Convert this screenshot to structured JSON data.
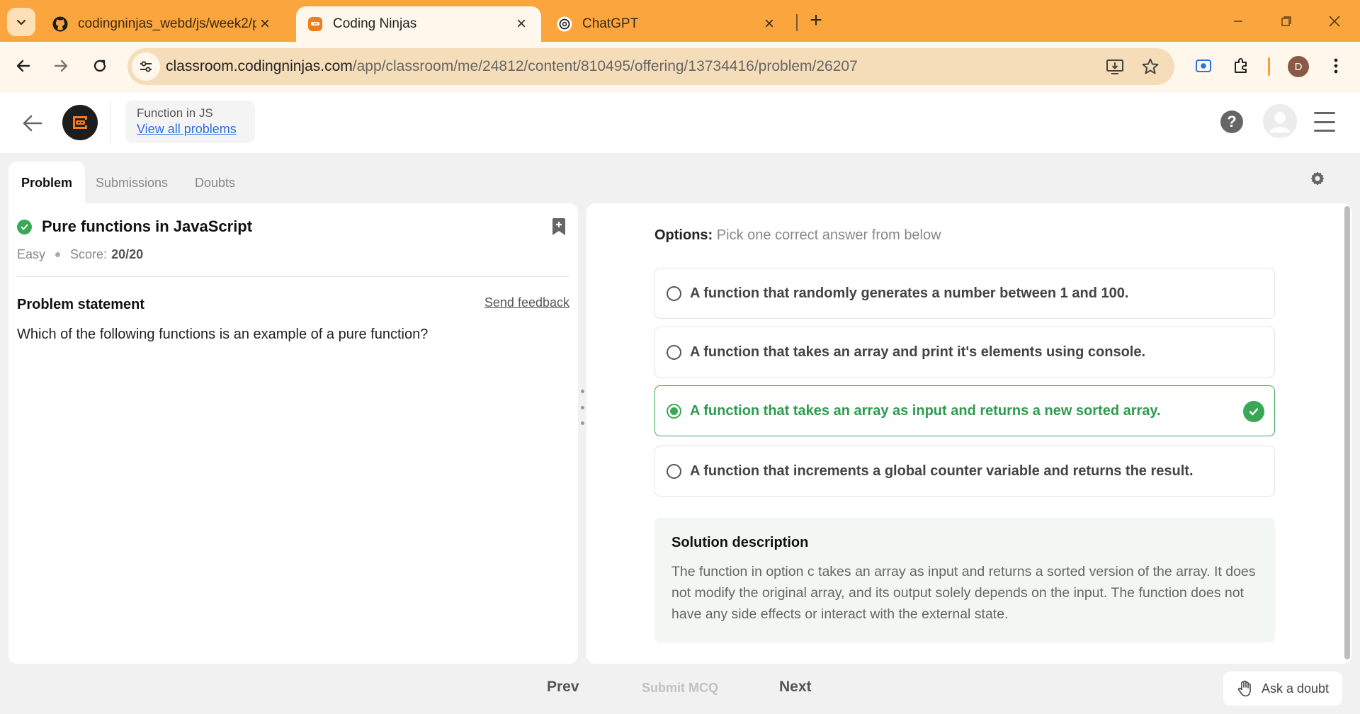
{
  "browser": {
    "tabs": [
      {
        "title": "codingninjas_webd/js/week2/p",
        "active": false
      },
      {
        "title": "Coding Ninjas",
        "active": true
      },
      {
        "title": "ChatGPT",
        "active": false
      }
    ],
    "url_host": "classroom.codingninjas.com",
    "url_path": "/app/classroom/me/24812/content/810495/offering/13734416/problem/26207",
    "profile_initial": "D",
    "accent_color": "#fba53f"
  },
  "header": {
    "breadcrumb_title": "Function in JS",
    "breadcrumb_link": "View all problems",
    "help_label": "?"
  },
  "tabs": {
    "problem": "Problem",
    "submissions": "Submissions",
    "doubts": "Doubts"
  },
  "problem": {
    "title": "Pure functions in JavaScript",
    "difficulty": "Easy",
    "score_label": "Score:",
    "score_value": "20/20",
    "statement_heading": "Problem statement",
    "feedback_link": "Send feedback",
    "statement": "Which of the following functions is an example of a pure function?"
  },
  "options": {
    "heading": "Options:",
    "hint": "Pick one correct answer from below",
    "items": [
      {
        "text": "A function that randomly generates a number between 1 and 100.",
        "selected": false
      },
      {
        "text": "A function that takes an array and print it's elements using console.",
        "selected": false
      },
      {
        "text": "A function that takes an array as input and returns a new sorted array.",
        "selected": true
      },
      {
        "text": "A function that increments a global counter variable and returns the result.",
        "selected": false
      }
    ],
    "correct_color": "#3aa756"
  },
  "solution": {
    "heading": "Solution description",
    "body": "The function in option c takes an array as input and returns a sorted version of the array. It does not modify the original array, and its output solely depends on the input. The function does not have any side effects or interact with the external state."
  },
  "footer": {
    "prev": "Prev",
    "submit": "Submit MCQ",
    "next": "Next",
    "ask": "Ask a doubt"
  }
}
